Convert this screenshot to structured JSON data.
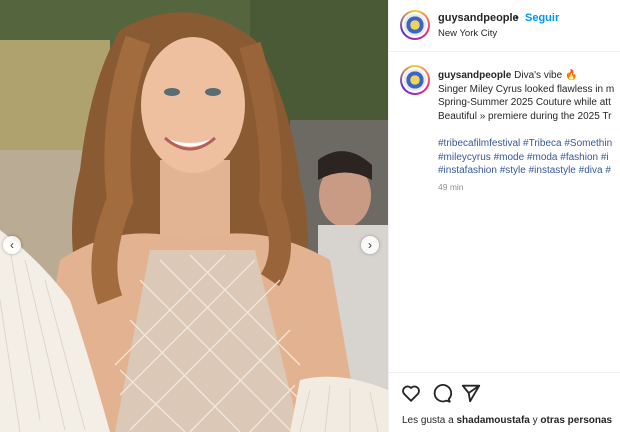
{
  "post": {
    "username": "guysandpeople",
    "separator": "•",
    "follow_label": "Seguir",
    "location": "New York City"
  },
  "caption": {
    "username": "guysandpeople",
    "title": "Diva's vibe",
    "lines": [
      "Singer Miley Cyrus looked flawless in m",
      "Spring-Summer 2025 Couture while att",
      "Beautiful » premiere during the 2025 Tr"
    ],
    "hashtag_lines": [
      "#tribecafilmfestival #Tribeca #Somethin",
      "#mileycyrus #mode #moda #fashion #i",
      "#instafashion #style #instastyle #diva #"
    ],
    "time": "49 min"
  },
  "actions": {
    "like_icon": "heart-icon",
    "comment_icon": "comment-icon",
    "share_icon": "send-icon"
  },
  "likes": {
    "prefix": "Les gusta a",
    "user": "shadamoustafa",
    "connector": "y",
    "others": "otras personas"
  },
  "nav": {
    "prev_glyph": "‹",
    "next_glyph": "›"
  },
  "colors": {
    "follow_blue": "#0095f6",
    "hashtag": "#385898"
  }
}
